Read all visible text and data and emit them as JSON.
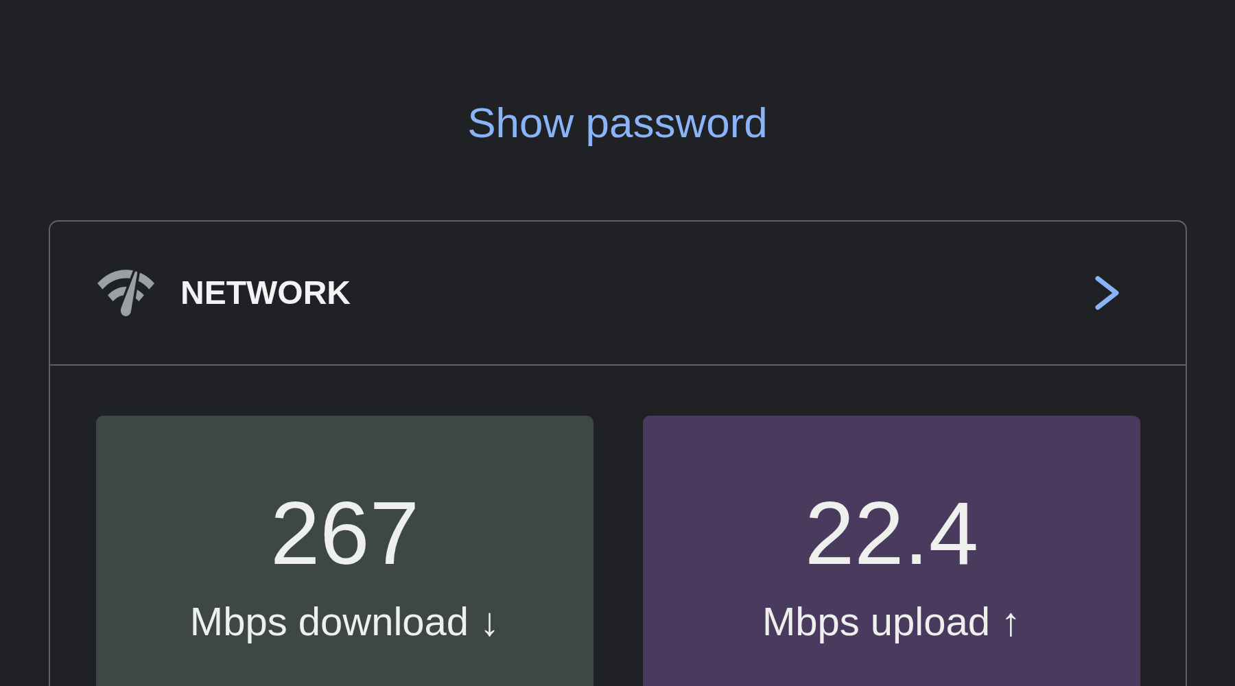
{
  "show_password_link": "Show password",
  "network_card": {
    "title": "NETWORK",
    "stats": [
      {
        "value": "267",
        "label": "Mbps download ↓",
        "color": "#3d4743"
      },
      {
        "value": "22.4",
        "label": "Mbps upload ↑",
        "color": "#4a3a5e"
      }
    ]
  }
}
